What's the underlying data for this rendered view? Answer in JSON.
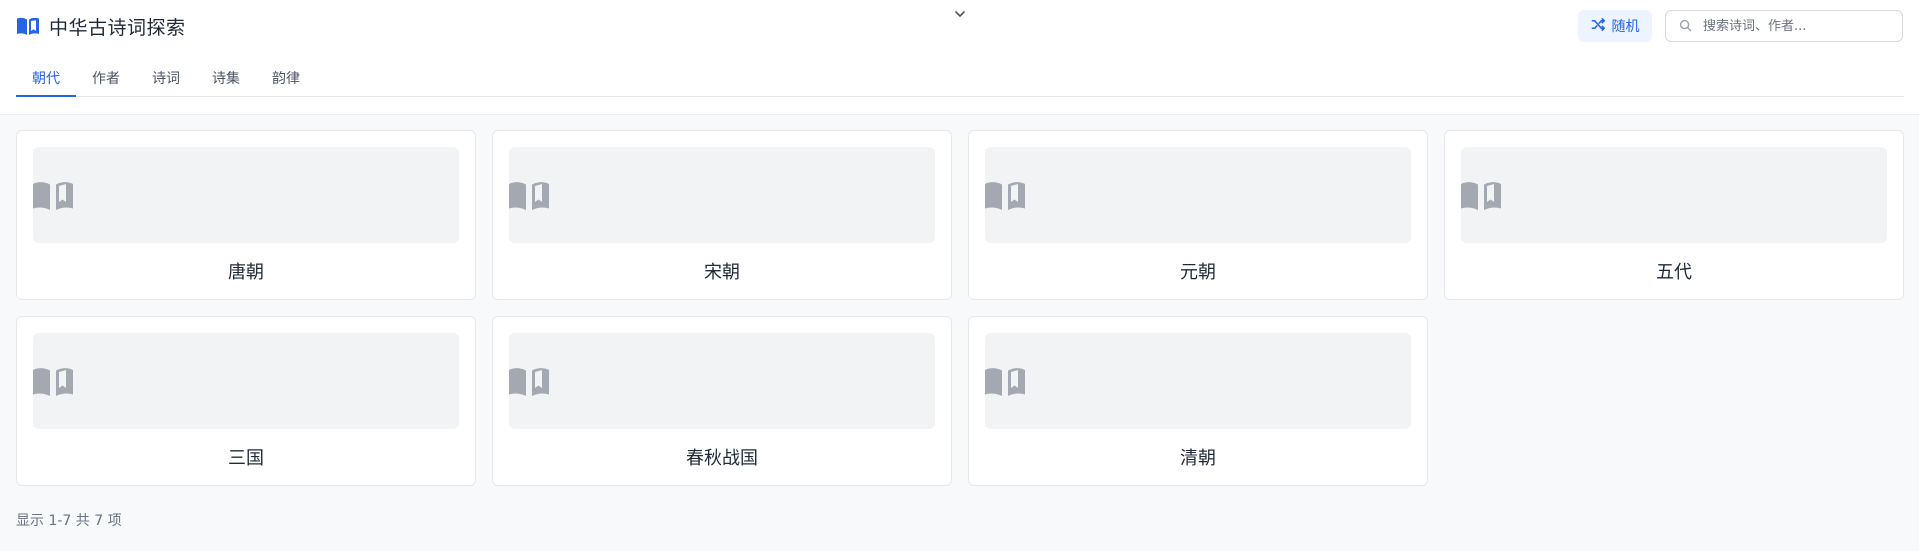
{
  "app": {
    "title": "中华古诗词探索"
  },
  "header": {
    "random_label": "随机",
    "search_placeholder": "搜索诗词、作者..."
  },
  "tabs": [
    {
      "label": "朝代",
      "active": true
    },
    {
      "label": "作者",
      "active": false
    },
    {
      "label": "诗词",
      "active": false
    },
    {
      "label": "诗集",
      "active": false
    },
    {
      "label": "韵律",
      "active": false
    }
  ],
  "cards": [
    {
      "title": "唐朝"
    },
    {
      "title": "宋朝"
    },
    {
      "title": "元朝"
    },
    {
      "title": "五代"
    },
    {
      "title": "三国"
    },
    {
      "title": "春秋战国"
    },
    {
      "title": "清朝"
    }
  ],
  "footer": {
    "text": "显示 1-7 共 7 项"
  },
  "icons": {
    "logo": "book-icon",
    "collapse": "chevron-down-icon",
    "random": "shuffle-icon",
    "search": "search-icon",
    "card_thumb": "book-open-icon"
  },
  "colors": {
    "accent": "#2563eb",
    "page_bg": "#f8f9fb",
    "card_thumb_bg": "#f2f3f5",
    "icon_gray": "#a3a8b1"
  }
}
